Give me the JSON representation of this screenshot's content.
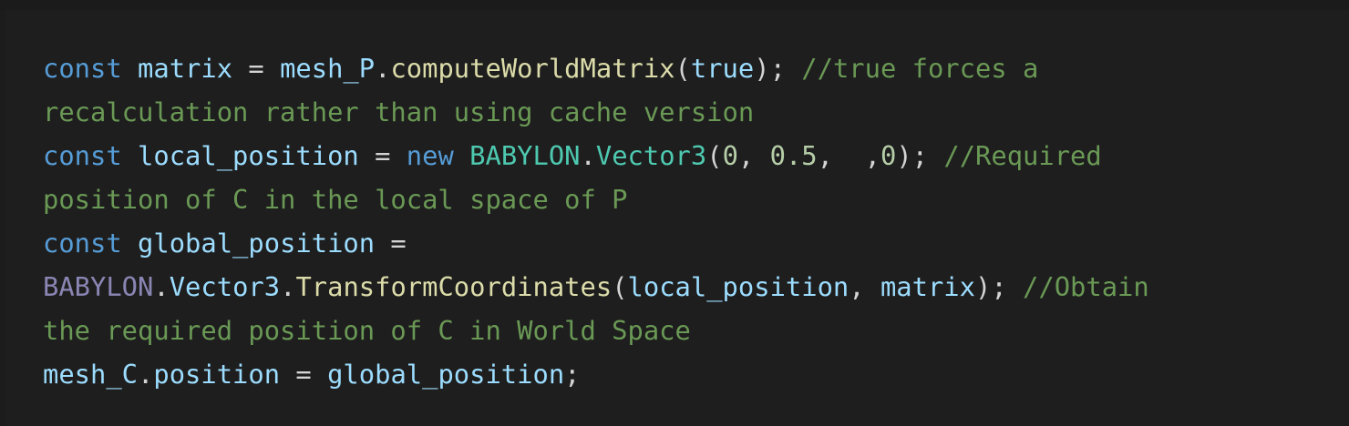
{
  "code_block": {
    "language": "javascript",
    "theme": {
      "background": "#1e1e1e",
      "keyword": "#569cd6",
      "variable": "#9cdcfe",
      "function": "#dcdcaa",
      "class": "#4ec9b0",
      "number": "#b5cea8",
      "comment": "#6a9955",
      "plain": "#d4d4d4"
    },
    "lines": [
      {
        "kw": "const",
        "v1": "matrix",
        "op": " = ",
        "obj": "mesh_P",
        "dot": ".",
        "fn": "computeWorldMatrix",
        "open": "(",
        "arg": "true",
        "close": ");",
        "comment": "//true forces a"
      },
      {
        "comment": "recalculation rather than using cache version"
      },
      {
        "kw": "const",
        "v1": "local_position",
        "op": " = ",
        "kw2": "new",
        "cls1": "BABYLON",
        "dot": ".",
        "cls2": "Vector3",
        "open": "(",
        "n1": "0",
        "sep1": ", ",
        "n2": "0.5",
        "sep2": ",  ,",
        "n3": "0",
        "close": ");",
        "comment": "//Required"
      },
      {
        "comment": "position of C in the local space of P"
      },
      {
        "kw": "const",
        "v1": "global_position",
        "op": " ="
      },
      {
        "ns": "BABYLON",
        "dot1": ".",
        "cls": "Vector3",
        "dot2": ".",
        "fn": "TransformCoordinates",
        "open": "(",
        "a1": "local_position",
        "sep": ", ",
        "a2": "matrix",
        "close": ");",
        "comment": "//Obtain"
      },
      {
        "comment": "the required position of C in World Space"
      },
      {
        "obj": "mesh_C",
        "dot": ".",
        "prop": "position",
        "op": " = ",
        "val": "global_position",
        "end": ";"
      }
    ]
  }
}
